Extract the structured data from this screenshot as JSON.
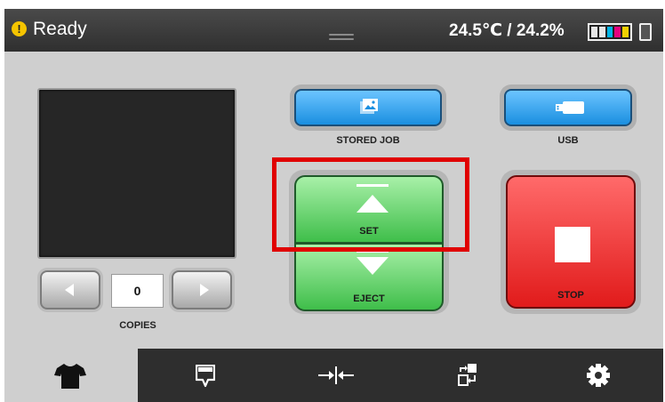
{
  "status": {
    "text": "Ready",
    "temperature_humidity": "24.5℃ / 24.2%"
  },
  "ink_levels": [
    "#e6e6e6",
    "#e6e6e6",
    "#00b4e6",
    "#e6007e",
    "#f0d000"
  ],
  "preview": {
    "state": "empty"
  },
  "copies": {
    "value": "0",
    "label": "COPIES"
  },
  "buttons": {
    "stored_job": "STORED JOB",
    "usb": "USB",
    "set": "SET",
    "eject": "EJECT",
    "stop": "STOP"
  },
  "tabs": [
    {
      "icon": "tshirt-icon",
      "active": true
    },
    {
      "icon": "print-head-icon",
      "active": false
    },
    {
      "icon": "align-icon",
      "active": false
    },
    {
      "icon": "transfer-icon",
      "active": false
    },
    {
      "icon": "gear-icon",
      "active": false
    }
  ],
  "colors": {
    "accent_blue": "#1a8fe0",
    "set_green": "#3fbe4a",
    "stop_red": "#e11b1b",
    "highlight": "#e00000"
  }
}
